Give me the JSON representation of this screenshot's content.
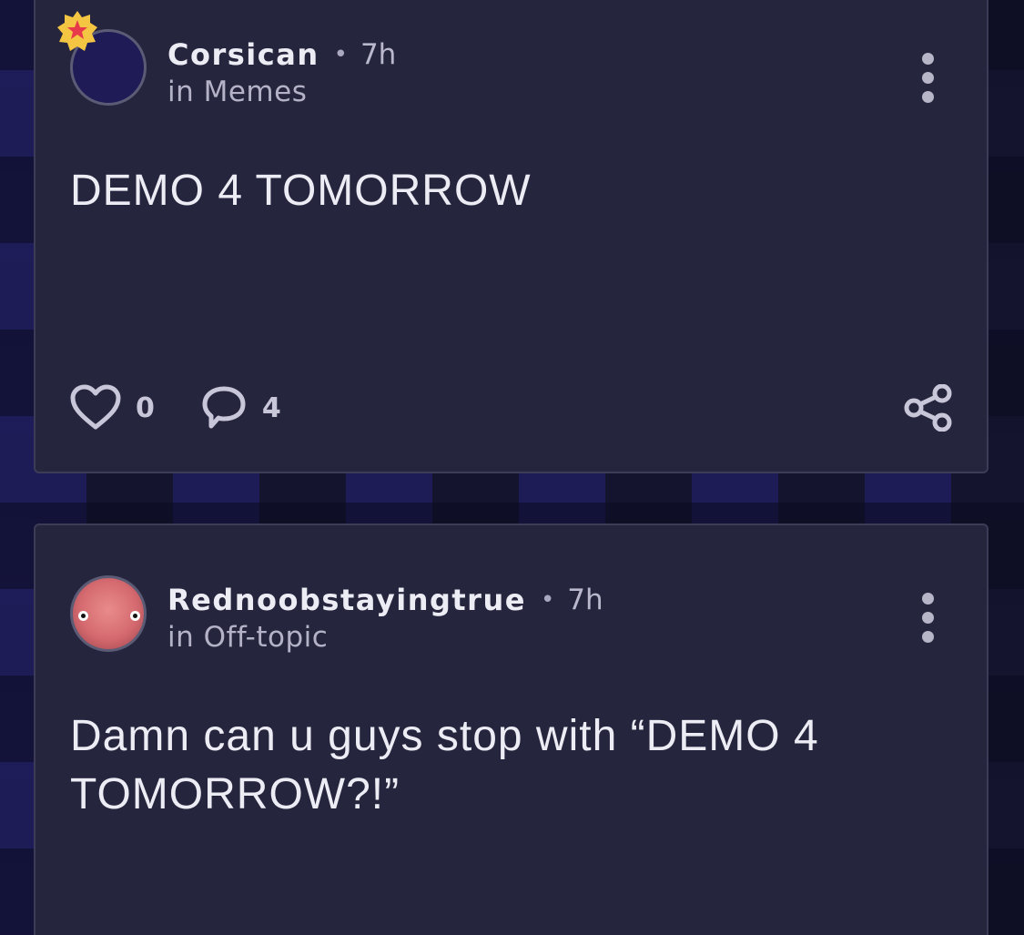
{
  "colors": {
    "card_bg": "#26253e",
    "card_border": "#3d3c57",
    "text_primary": "#ececf4",
    "text_secondary": "#b3b2c6",
    "badge_yellow": "#f4c542",
    "badge_star": "#e8394b"
  },
  "posts": [
    {
      "author": "Corsican",
      "time": "7h",
      "channel": "in Memes",
      "body": "DEMO 4 TOMORROW",
      "likes": "0",
      "comments": "4",
      "has_badge": true,
      "icons": [
        "star-badge-icon",
        "more-vertical-icon",
        "heart-icon",
        "comment-icon",
        "share-icon"
      ]
    },
    {
      "author": "Rednoobstayingtrue",
      "time": "7h",
      "channel": "in Off-topic",
      "body": "Damn can u guys stop with “DEMO 4 TOMORROW?!”",
      "icons": [
        "more-vertical-icon"
      ]
    }
  ]
}
